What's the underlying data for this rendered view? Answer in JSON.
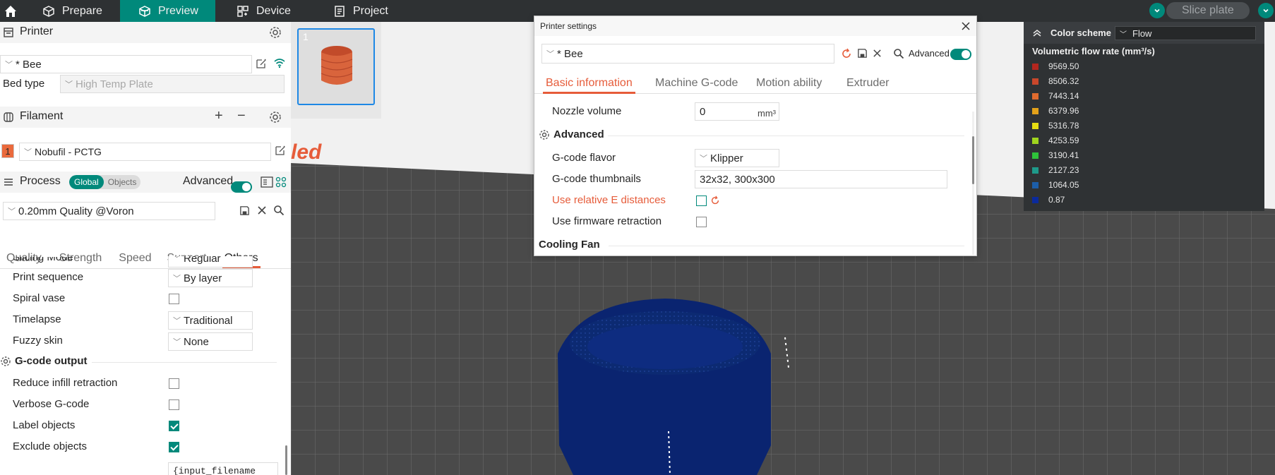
{
  "nav": {
    "tabs": [
      {
        "label": "Prepare",
        "icon": "cube-icon"
      },
      {
        "label": "Preview",
        "icon": "preview-cube-icon"
      },
      {
        "label": "Device",
        "icon": "device-icon"
      },
      {
        "label": "Project",
        "icon": "project-icon"
      }
    ],
    "slice_label": "Slice plate"
  },
  "printer": {
    "title": "Printer",
    "preset": "* Bee",
    "bed_type_label": "Bed type",
    "bed_type": "High Temp Plate"
  },
  "filament": {
    "title": "Filament",
    "slot": "1",
    "slot_color": "#ea6a3c",
    "name": "Nobufil - PCTG"
  },
  "process": {
    "title": "Process",
    "scope_global": "Global",
    "scope_objects": "Objects",
    "advanced_label": "Advanced",
    "preset": "0.20mm Quality @Voron",
    "tabs": [
      "Quality",
      "Strength",
      "Speed",
      "Support",
      "Others"
    ],
    "active_tab": "Others",
    "rows": [
      {
        "label": "Slicing Mode",
        "value": "Regular"
      },
      {
        "label": "Print sequence",
        "value": "By layer"
      },
      {
        "label": "Spiral vase"
      },
      {
        "label": "Timelapse",
        "value": "Traditional"
      },
      {
        "label": "Fuzzy skin",
        "value": "None"
      }
    ],
    "gcode_output": {
      "title": "G-code output",
      "rows": [
        {
          "label": "Reduce infill retraction",
          "checked": false
        },
        {
          "label": "Verbose G-code",
          "checked": false
        },
        {
          "label": "Label objects",
          "checked": true
        },
        {
          "label": "Exclude objects",
          "checked": true
        }
      ],
      "filename_value": "{input_filename"
    }
  },
  "viewport": {
    "plate_number": "1",
    "plate_text": "led"
  },
  "dialog": {
    "title": "Printer settings",
    "preset": "* Bee",
    "advanced_label": "Advanced",
    "tabs": [
      "Basic information",
      "Machine G-code",
      "Motion ability",
      "Extruder"
    ],
    "nozzle_volume_label": "Nozzle volume",
    "nozzle_volume_value": "0",
    "nozzle_volume_unit": "mm³",
    "advanced_group": "Advanced",
    "gcode_flavor_label": "G-code flavor",
    "gcode_flavor_value": "Klipper",
    "gcode_thumbnails_label": "G-code thumbnails",
    "gcode_thumbnails_value": "32x32, 300x300",
    "relative_e_label": "Use relative E distances",
    "firmware_retraction_label": "Use firmware retraction",
    "cooling_group": "Cooling Fan"
  },
  "legend": {
    "scheme_label": "Color scheme",
    "scheme_value": "Flow",
    "title": "Volumetric flow rate (mm³/s)",
    "items": [
      {
        "value": "9569.50",
        "color": "#b3261e"
      },
      {
        "value": "8506.32",
        "color": "#c9472b"
      },
      {
        "value": "7443.14",
        "color": "#e06b2e"
      },
      {
        "value": "6379.96",
        "color": "#e3a21a"
      },
      {
        "value": "5316.78",
        "color": "#e5dd12"
      },
      {
        "value": "4253.59",
        "color": "#9fd41e"
      },
      {
        "value": "3190.41",
        "color": "#2ec23a"
      },
      {
        "value": "2127.23",
        "color": "#1e9a8a"
      },
      {
        "value": "1064.05",
        "color": "#1c5ea8"
      },
      {
        "value": "0.87",
        "color": "#0b2a9c"
      }
    ]
  }
}
